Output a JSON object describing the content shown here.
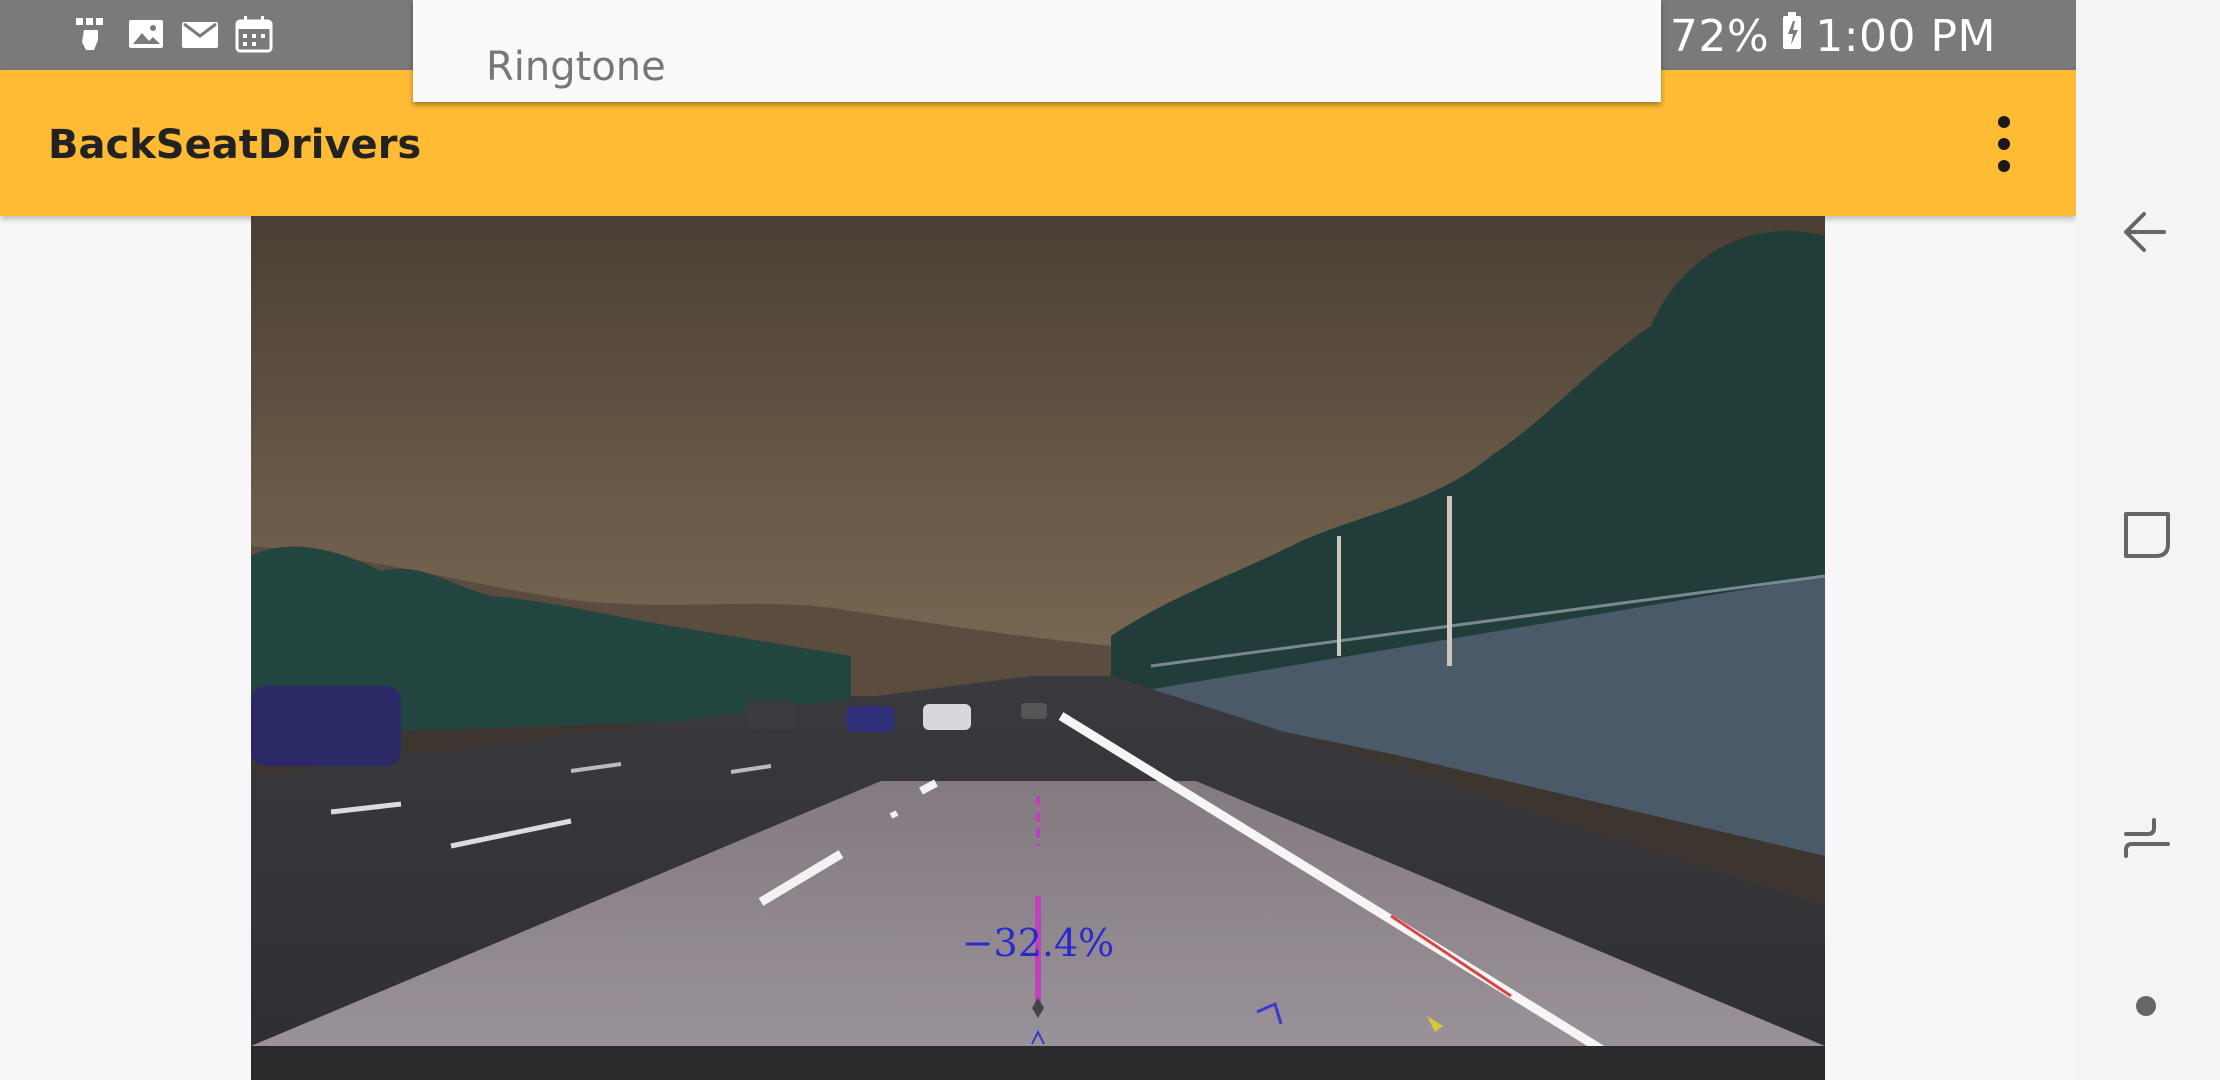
{
  "status_bar": {
    "battery": "72%",
    "time": "1:00 PM",
    "left_icons": [
      "robot-hand-icon",
      "image-icon",
      "mail-icon",
      "calendar-icon"
    ],
    "right_icons": [
      "signal-icon",
      "battery-charging-icon"
    ]
  },
  "notification": {
    "text": "Ringtone"
  },
  "app_bar": {
    "title": "BackSeatDrivers",
    "menu_icon": "more-vert-icon",
    "color": "#ffbb33"
  },
  "camera": {
    "lane_offset_label": "−32.4%"
  },
  "nav_bar": {
    "icons": [
      "back-icon",
      "recents-icon",
      "switch-apps-icon",
      "home-dot-icon"
    ]
  }
}
